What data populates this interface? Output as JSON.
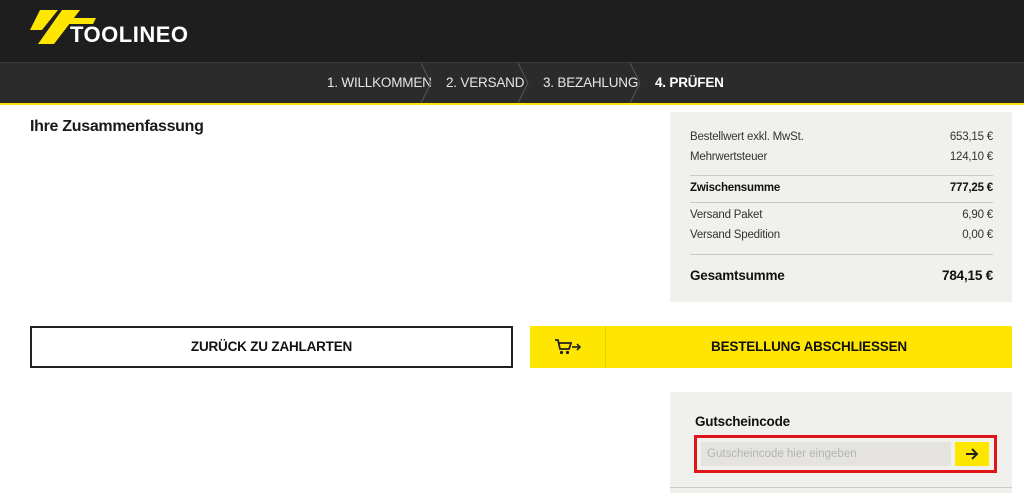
{
  "brand": {
    "name": "TOOLINEO",
    "accent": "#ffe600",
    "dark": "#1e1e1e"
  },
  "steps": [
    {
      "label": "1. WILLKOMMEN",
      "active": false
    },
    {
      "label": "2. VERSAND",
      "active": false
    },
    {
      "label": "3. BEZAHLUNG",
      "active": false
    },
    {
      "label": "4. PRÜFEN",
      "active": true
    }
  ],
  "page": {
    "title": "Ihre Zusammenfassung"
  },
  "summary": {
    "rows": [
      {
        "label": "Bestellwert exkl. MwSt.",
        "value": "653,15 €"
      },
      {
        "label": "Mehrwertsteuer",
        "value": "124,10 €"
      },
      {
        "label": "Zwischensumme",
        "value": "777,25 €"
      },
      {
        "label": "Versand Paket",
        "value": "6,90 €"
      },
      {
        "label": "Versand Spedition",
        "value": "0,00 €"
      },
      {
        "label": "Gesamtsumme",
        "value": "784,15 €"
      }
    ]
  },
  "actions": {
    "back_label": "ZURÜCK ZU ZAHLARTEN",
    "order_label": "BESTELLUNG ABSCHLIESSEN",
    "order_icon": "cart-arrow-icon"
  },
  "voucher": {
    "title": "Gutscheincode",
    "placeholder": "Gutscheincode hier eingeben",
    "value": "",
    "submit_icon": "arrow-right-icon",
    "highlight_color": "#e0151b"
  }
}
